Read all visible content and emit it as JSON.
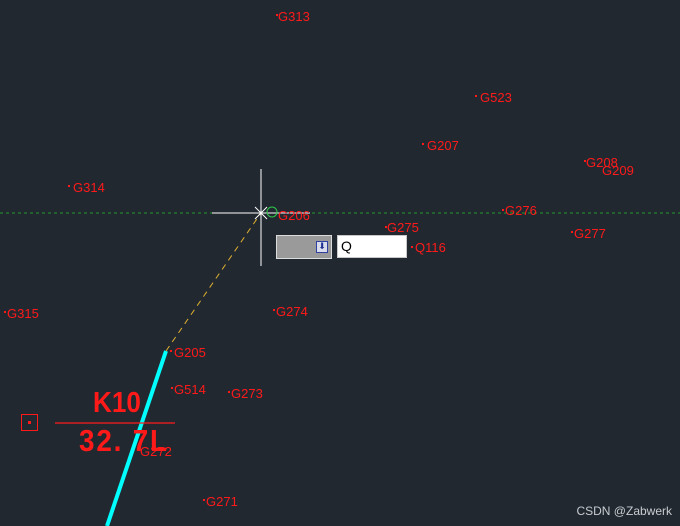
{
  "points": [
    {
      "id": "G313",
      "label": "G313"
    },
    {
      "id": "G523",
      "label": "G523"
    },
    {
      "id": "G207",
      "label": "G207"
    },
    {
      "id": "G208",
      "label": "G208"
    },
    {
      "id": "G209",
      "label": "G209"
    },
    {
      "id": "G314",
      "label": "G314"
    },
    {
      "id": "G206",
      "label": "G206"
    },
    {
      "id": "G275",
      "label": "G275"
    },
    {
      "id": "G276",
      "label": "G276"
    },
    {
      "id": "G277",
      "label": "G277"
    },
    {
      "id": "Q116",
      "label": "Q116"
    },
    {
      "id": "G315",
      "label": "G315"
    },
    {
      "id": "G274",
      "label": "G274"
    },
    {
      "id": "G205",
      "label": "G205"
    },
    {
      "id": "G514",
      "label": "G514"
    },
    {
      "id": "G273",
      "label": "G273"
    },
    {
      "id": "G272",
      "label": "G272"
    },
    {
      "id": "G271",
      "label": "G271"
    }
  ],
  "annotation": {
    "name": "K10",
    "value": "32. 7L"
  },
  "command_bar": {
    "input_value": "Q",
    "dropdown_icon": "arrow-down-icon"
  },
  "watermark": "CSDN @Zabwerk",
  "colors": {
    "background": "#212830",
    "label": "#ff1a1a",
    "polyline": "#00ffff",
    "rubber_band": "#e0b030",
    "guide": "#1f9a2a",
    "crosshair": "#ffffff"
  }
}
